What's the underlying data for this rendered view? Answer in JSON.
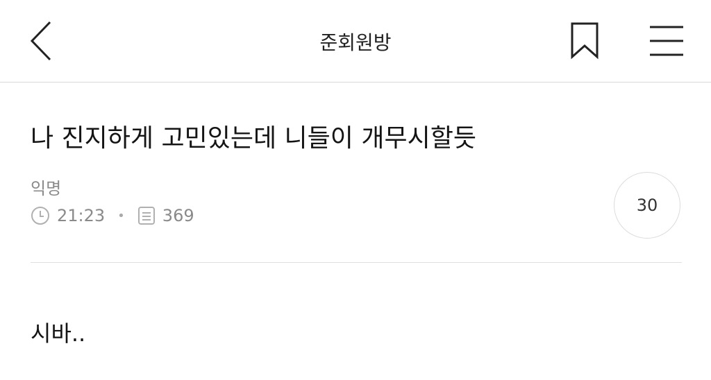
{
  "header": {
    "title": "준회원방",
    "back_icon": "chevron-left-icon",
    "bookmark_icon": "bookmark-icon",
    "menu_icon": "hamburger-menu-icon"
  },
  "post": {
    "title": "나 진지하게 고민있는데 니들이 개무시할듯",
    "author": "익명",
    "time": "21:23",
    "views": "369",
    "comment_count": "30",
    "body": "시바.."
  }
}
